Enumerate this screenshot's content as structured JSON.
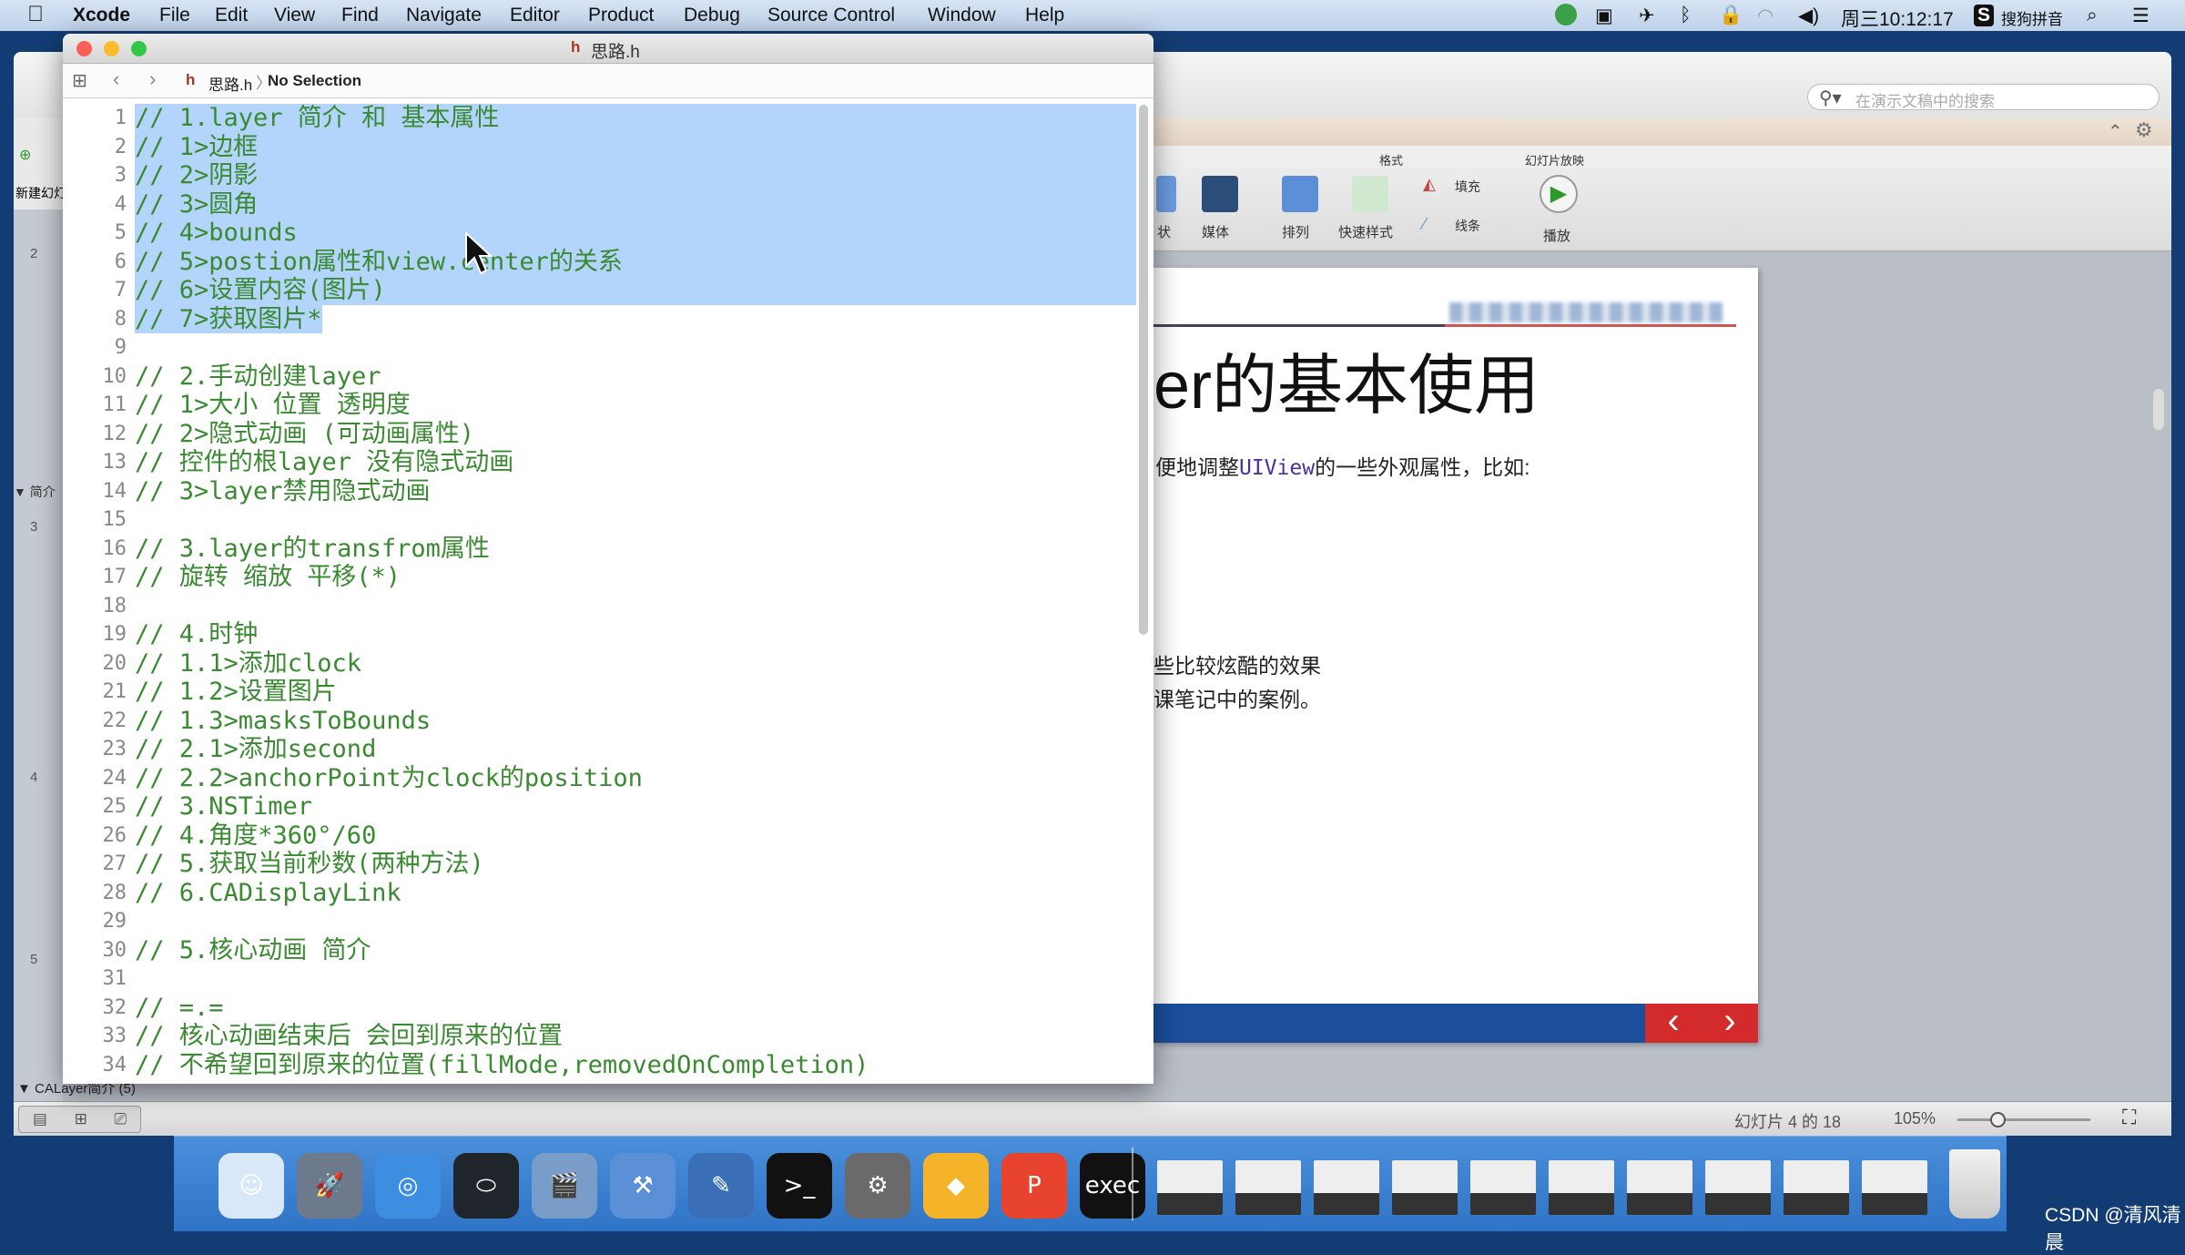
{
  "menubar": {
    "app": "Xcode",
    "items": [
      "File",
      "Edit",
      "View",
      "Find",
      "Navigate",
      "Editor",
      "Product",
      "Debug",
      "Source Control",
      "Window",
      "Help"
    ],
    "clock": "周三10:12:17",
    "input_method": "搜狗拼音",
    "status_icons": [
      "screen-recorder-icon",
      "camera-icon",
      "airplane-icon",
      "bluetooth-icon",
      "lock-icon",
      "wifi-icon",
      "volume-icon",
      "sogou-icon",
      "spotlight-icon",
      "notification-list-icon"
    ]
  },
  "xcode": {
    "window_title": "思路.h",
    "jump_bar": {
      "file": "思路.h",
      "selection": "No Selection"
    },
    "code_lines": [
      "// 1.layer 简介 和 基本属性",
      "// 1>边框",
      "// 2>阴影",
      "// 3>圆角",
      "// 4>bounds",
      "// 5>postion属性和view.center的关系",
      "// 6>设置内容(图片)",
      "// 7>获取图片*",
      "",
      "// 2.手动创建layer",
      "// 1>大小 位置 透明度",
      "// 2>隐式动画 (可动画属性)",
      "// 控件的根layer 没有隐式动画",
      "// 3>layer禁用隐式动画",
      "",
      "// 3.layer的transfrom属性",
      "// 旋转 缩放 平移(*)",
      "",
      "// 4.时钟",
      "// 1.1>添加clock",
      "// 1.2>设置图片",
      "// 1.3>masksToBounds",
      "// 2.1>添加second",
      "// 2.2>anchorPoint为clock的position",
      "// 3.NSTimer",
      "// 4.角度*360°/60",
      "// 5.获取当前秒数(两种方法)",
      "// 6.CADisplayLink",
      "",
      "// 5.核心动画 简介",
      "",
      "// =.=",
      "// 核心动画结束后 会回到原来的位置",
      "// 不希望回到原来的位置(fillMode,removedOnCompletion)"
    ],
    "selected_lines": [
      1,
      8
    ],
    "colors": {
      "comment": "#3a8a32",
      "selection": "#b3d4fb"
    }
  },
  "powerpoint": {
    "search_placeholder": "在演示文稿中的搜索",
    "left_panel": {
      "new_slide": "新建幻灯片",
      "section": "▼ 简介",
      "slide_numbers": [
        "2",
        "3",
        "4",
        "5"
      ],
      "bottom_section": "▼ CALayer简介 (5)"
    },
    "ribbon": {
      "group_format": "格式",
      "group_slideshow": "幻灯片放映",
      "shape_partial": "状",
      "media": "媒体",
      "arrange": "排列",
      "quick_styles": "快速样式",
      "fill": "填充",
      "line": "线条",
      "play": "播放"
    },
    "slide": {
      "title": "er的基本使用",
      "body1_pre": "便地调整",
      "body1_code": "UIView",
      "body1_post": "的一些外观属性，比如:",
      "body2": "些比较炫酷的效果",
      "body3": "课笔记中的案例。",
      "footer_color": "#1b4f9c",
      "nav_color": "#d32b2b",
      "prev": "‹",
      "next": "›"
    },
    "status": {
      "slide_counter": "幻灯片 4 的 18",
      "zoom": "105%",
      "zoom_slider_fraction": 0.3
    }
  },
  "dock": {
    "apps": [
      "finder-icon",
      "launchpad-icon",
      "safari-icon",
      "mouse-app-icon",
      "imovie-icon",
      "xcode-icon",
      "instruments-icon",
      "terminal-icon",
      "system-preferences-icon",
      "sketch-icon",
      "wps-presentation-icon",
      "exec-terminal-icon"
    ],
    "windows_count": 10
  },
  "watermark": "CSDN @清风清晨"
}
